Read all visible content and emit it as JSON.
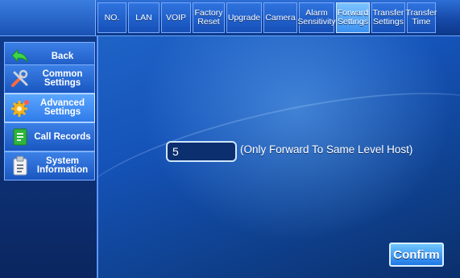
{
  "tabs": [
    {
      "label": "NO."
    },
    {
      "label": "LAN"
    },
    {
      "label": "VOIP"
    },
    {
      "label": "Factory\nReset"
    },
    {
      "label": "Upgrade"
    },
    {
      "label": "Camera"
    },
    {
      "label": "Alarm\nSensitivity"
    },
    {
      "label": "Forward\nSettings",
      "active": true
    },
    {
      "label": "Transfer\nSettings"
    },
    {
      "label": "Transfer\nTime"
    }
  ],
  "sidebar": {
    "items": [
      {
        "label": "Back",
        "icon": "back-arrow-icon"
      },
      {
        "label": "Common\nSettings",
        "icon": "tools-icon"
      },
      {
        "label": "Advanced\nSettings",
        "icon": "gear-icon",
        "active": true
      },
      {
        "label": "Call Records",
        "icon": "call-records-icon"
      },
      {
        "label": "System\nInformation",
        "icon": "clipboard-icon"
      }
    ]
  },
  "forward": {
    "value": "5",
    "hint": "(Only Forward To Same Level Host)"
  },
  "actions": {
    "confirm_label": "Confirm"
  },
  "colors": {
    "active_tab": "#5aaeff",
    "background": "#1553b8",
    "border": "#7fb1ff"
  }
}
